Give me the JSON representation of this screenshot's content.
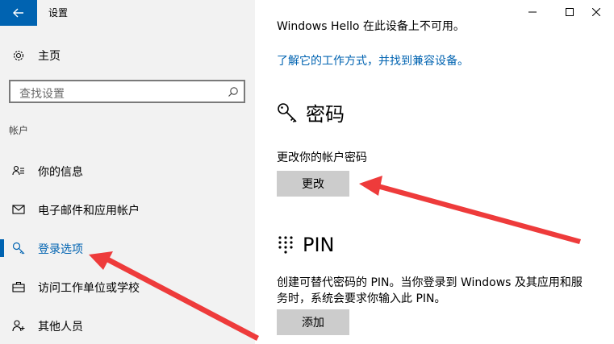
{
  "app": {
    "title": "设置"
  },
  "sidebar": {
    "home_label": "主页",
    "search_placeholder": "查找设置",
    "section_label": "帐户",
    "items": [
      {
        "label": "你的信息",
        "icon": "person-list-icon"
      },
      {
        "label": "电子邮件和应用帐户",
        "icon": "mail-icon"
      },
      {
        "label": "登录选项",
        "icon": "key-icon",
        "active": true
      },
      {
        "label": "访问工作单位或学校",
        "icon": "briefcase-icon"
      },
      {
        "label": "其他人员",
        "icon": "person-add-icon"
      }
    ]
  },
  "main": {
    "hello_text": "Windows Hello 在此设备上不可用。",
    "hello_link": "了解它的工作方式，并找到兼容设备。",
    "password": {
      "title": "密码",
      "desc": "更改你的帐户密码",
      "button": "更改"
    },
    "pin": {
      "title": "PIN",
      "desc_line1": "创建可替代密码的 PIN。当你登录到 Windows 及其应用和服",
      "desc_line2": "务时，系统会要求你输入此 PIN。",
      "button": "添加"
    }
  },
  "colors": {
    "accent": "#0063b1",
    "sidebar_bg": "#f2f2f2",
    "button_bg": "#cccccc",
    "arrow": "#ee3b3b"
  }
}
